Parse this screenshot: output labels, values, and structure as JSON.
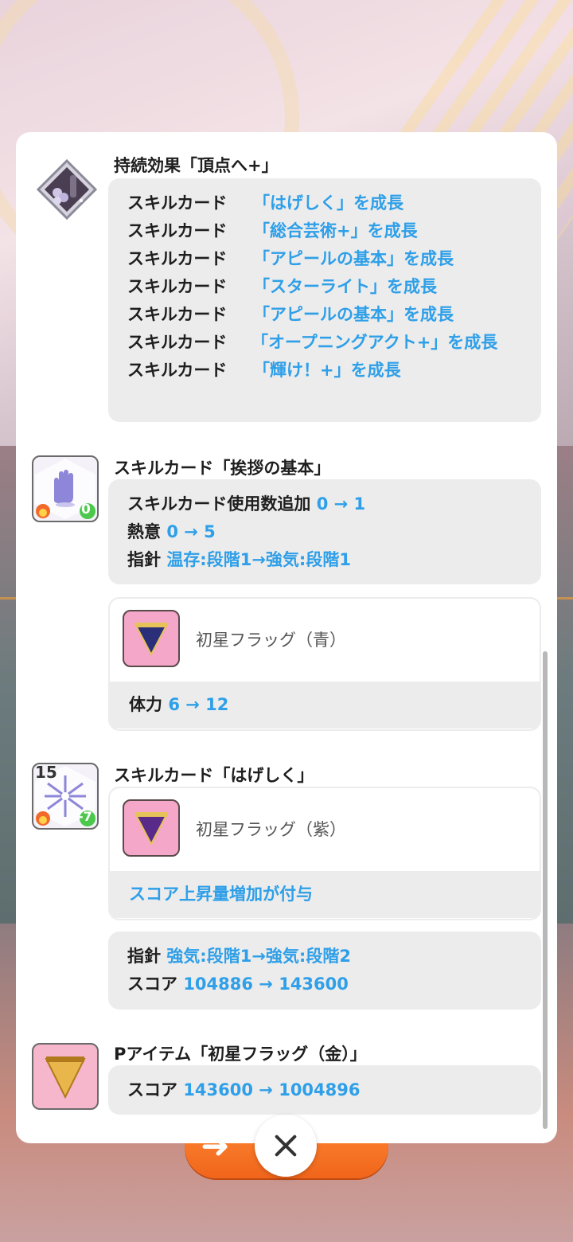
{
  "effect": {
    "title": "持続効果「頂点へ+」",
    "lines": [
      {
        "label": "スキルカード",
        "value": "「はげしく」を成長"
      },
      {
        "label": "スキルカード",
        "value": "「総合芸術+」を成長"
      },
      {
        "label": "スキルカード",
        "value": "「アピールの基本」を成長"
      },
      {
        "label": "スキルカード",
        "value": "「スターライト」を成長"
      },
      {
        "label": "スキルカード",
        "value": "「アピールの基本」を成長"
      },
      {
        "label": "スキルカード",
        "value": "「オープニングアクト+」を成長"
      },
      {
        "label": "スキルカード",
        "value": "「輝け！+」を成長"
      }
    ]
  },
  "card1": {
    "title": "スキルカード「挨拶の基本」",
    "badge": "0",
    "lines": [
      {
        "label": "スキルカード使用数追加",
        "value": "0 → 1"
      },
      {
        "label": "熱意",
        "value": "0 → 5"
      },
      {
        "label": "指針",
        "value": "温存:段階1→強気:段階1"
      }
    ],
    "item": {
      "name": "初星フラッグ（青）",
      "stat_label": "体力",
      "stat_value": "6 → 12"
    }
  },
  "card2": {
    "title": "スキルカード「はげしく」",
    "level": "15",
    "badge": "-7",
    "item": {
      "name": "初星フラッグ（紫）",
      "effect": "スコア上昇量増加が付与"
    },
    "lines": [
      {
        "label": "指針",
        "value": "強気:段階1→強気:段階2"
      },
      {
        "label": "スコア",
        "value": "104886 → 143600"
      }
    ]
  },
  "pitem": {
    "title": "Pアイテム「初星フラッグ（金）」",
    "lines": [
      {
        "label": "スコア",
        "value": "143600 → 1004896"
      }
    ]
  },
  "colors": {
    "accent": "#2e9fe8",
    "next_button": "#f0651b"
  },
  "icons": [
    "diamond-effect-icon",
    "glove-card-icon",
    "burst-card-icon",
    "blue-flag-icon",
    "purple-flag-icon",
    "gold-flag-icon",
    "close-icon",
    "arrow-right-icon"
  ]
}
